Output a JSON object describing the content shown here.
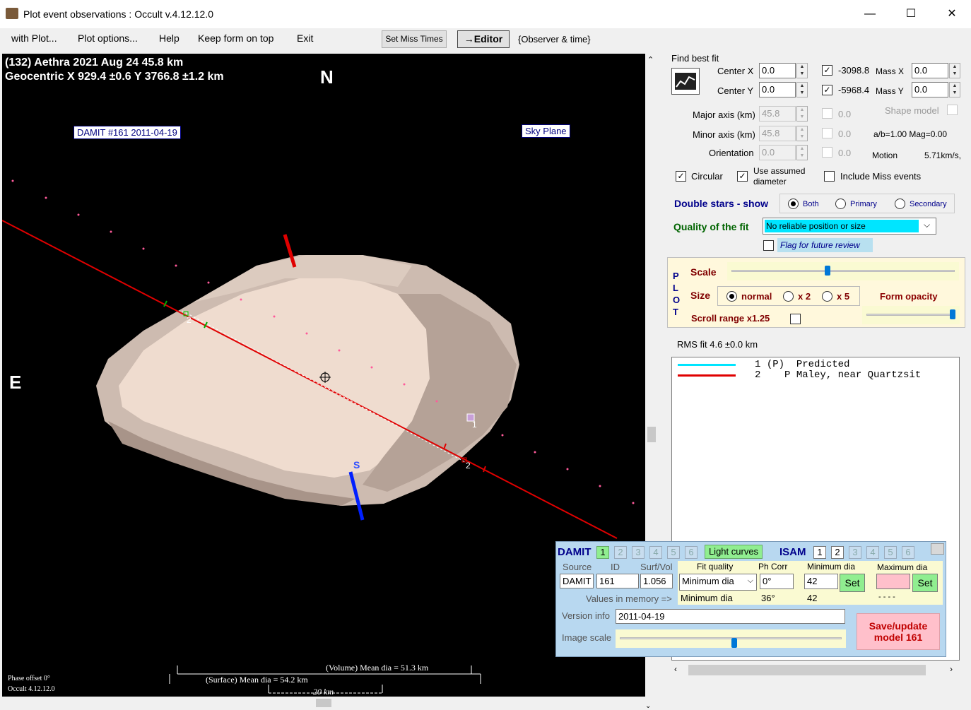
{
  "window": {
    "title": "Plot event observations : Occult v.4.12.12.0",
    "minimize": "—",
    "maximize": "☐",
    "close": "✕"
  },
  "menu": {
    "items": [
      "with Plot...",
      "Plot options...",
      "Help",
      "Keep form on top",
      "Exit"
    ],
    "set_miss_times": "Set Miss Times",
    "editor": "→Editor",
    "observer_time": "{Observer & time}"
  },
  "plot": {
    "header_line1": "(132) Aethra  2021 Aug 24   45.8 km",
    "header_line2": "Geocentric  X  929.4 ±0.6  Y 3766.8 ±1.2 km",
    "north": "N",
    "east": "E",
    "south": "S",
    "damit_label": "DAMIT #161 2011-04-19",
    "sky_plane": "Sky Plane",
    "chord_label_1": "1",
    "chord_label_2a": "2",
    "chord_label_2b": "2",
    "volume_dia": "(Volume) Mean dia = 51.3 km",
    "surface_dia": "(Surface) Mean dia = 54.2 km",
    "scale_bar": "20 km",
    "phase_offset": "Phase offset 0°",
    "occult_version": "Occult 4.12.12.0"
  },
  "fit": {
    "find_best_fit": "Find best fit",
    "center_x_label": "Center X",
    "center_x": "0.0",
    "center_y_label": "Center Y",
    "center_y": "0.0",
    "x_value": "-3098.8",
    "y_value": "-5968.4",
    "mass_x_label": "Mass X",
    "mass_x": "0.0",
    "mass_y_label": "Mass Y",
    "mass_y": "0.0",
    "major_axis_label": "Major axis (km)",
    "major_axis": "45.8",
    "minor_axis_label": "Minor axis (km)",
    "minor_axis": "45.8",
    "orientation_label": "Orientation",
    "orientation": "0.0",
    "dis_val1": "0.0",
    "dis_val2": "0.0",
    "dis_val3": "0.0",
    "shape_model": "Shape model",
    "ab_mag": "a/b=1.00 Mag=0.00",
    "motion_label": "Motion",
    "motion_value": "5.71km/s,",
    "circular": "Circular",
    "use_assumed_diameter": "Use assumed diameter",
    "include_miss": "Include Miss events",
    "double_stars": "Double stars - show",
    "both": "Both",
    "primary": "Primary",
    "secondary": "Secondary",
    "quality_label": "Quality of the fit",
    "quality_value": "No reliable position or size",
    "flag_review": "Flag for future review"
  },
  "plot_options": {
    "vertical": [
      "P",
      "L",
      "O",
      "T"
    ],
    "scale": "Scale",
    "size": "Size",
    "normal": "normal",
    "x2": "x 2",
    "x5": "x 5",
    "form_opacity": "Form opacity",
    "scroll_range": "Scroll range x1.25"
  },
  "rms": "RMS fit 4.6 ±0.0 km",
  "legend": [
    {
      "num": "1",
      "code": "(P)",
      "text": "Predicted",
      "color": "#00e5ff"
    },
    {
      "num": "2",
      "code": "P",
      "text": "Maley, near Quartzsit",
      "color": "#e00000"
    }
  ],
  "damit": {
    "title": "DAMIT",
    "nums": [
      "1",
      "2",
      "3",
      "4",
      "5",
      "6"
    ],
    "light_curves": "Light curves",
    "isam": "ISAM",
    "isam_nums": [
      "1",
      "2",
      "3",
      "4",
      "5",
      "6"
    ],
    "source_label": "Source",
    "id_label": "ID",
    "surfvol_label": "Surf/Vol",
    "source": "DAMIT",
    "id": "161",
    "surfvol": "1.056",
    "fit_quality_label": "Fit quality",
    "ph_corr_label": "Ph Corr",
    "min_dia_label": "Minimum dia",
    "max_dia_label": "Maximum dia",
    "fit_quality": "Minimum dia",
    "ph_corr": "0°",
    "min_dia": "42",
    "set": "Set",
    "values_in_memory": "Values in memory =>",
    "mem_fit": "Minimum dia",
    "mem_ph": "36°",
    "mem_min": "42",
    "mem_max": "- - - -",
    "version_label": "Version info",
    "version": "2011-04-19",
    "image_scale": "Image scale",
    "save": "Save/update model 161"
  }
}
